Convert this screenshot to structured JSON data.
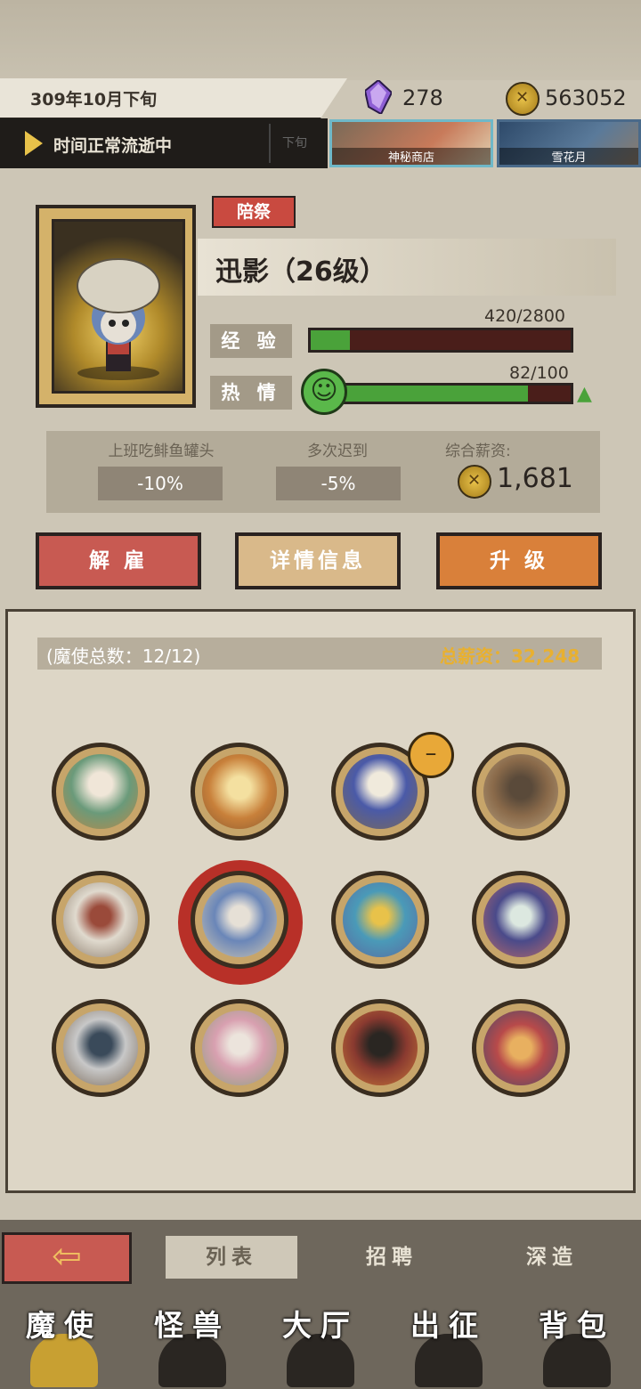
{
  "top": {
    "date": "309年10月下旬",
    "gems": "278",
    "gold": "563052",
    "time_status": "时间正常流逝中",
    "time_segment": "下旬",
    "shop_tiles": [
      "神秘商店",
      "雪花月"
    ]
  },
  "character": {
    "role_tag": "陪祭",
    "name": "迅影（26级）",
    "exp_label": "经 验",
    "exp_value": "420/2800",
    "exp_fraction": 0.15,
    "passion_label": "热 情",
    "passion_value": "82/100",
    "passion_fraction": 0.82,
    "modifiers": [
      {
        "title": "上班吃鲱鱼罐头",
        "value": "-10%"
      },
      {
        "title": "多次迟到",
        "value": "-5%"
      }
    ],
    "salary_label": "综合薪资:",
    "salary_value": "1,681"
  },
  "actions": {
    "fire": "解 雇",
    "details": "详情信息",
    "upgrade": "升 级"
  },
  "list": {
    "count": "(魔使总数：12/12)",
    "total_salary": "总薪资：32,248"
  },
  "subtabs": {
    "list": "列表",
    "recruit": "招聘",
    "deepen": "深造"
  },
  "main_tabs": [
    "魔使",
    "怪兽",
    "大厅",
    "出征",
    "背包"
  ],
  "colors": {
    "fire_btn": "#c85a52",
    "details_btn": "#d9b98a",
    "upgrade_btn": "#d9803a",
    "exp_fill": "#4aa23a"
  }
}
